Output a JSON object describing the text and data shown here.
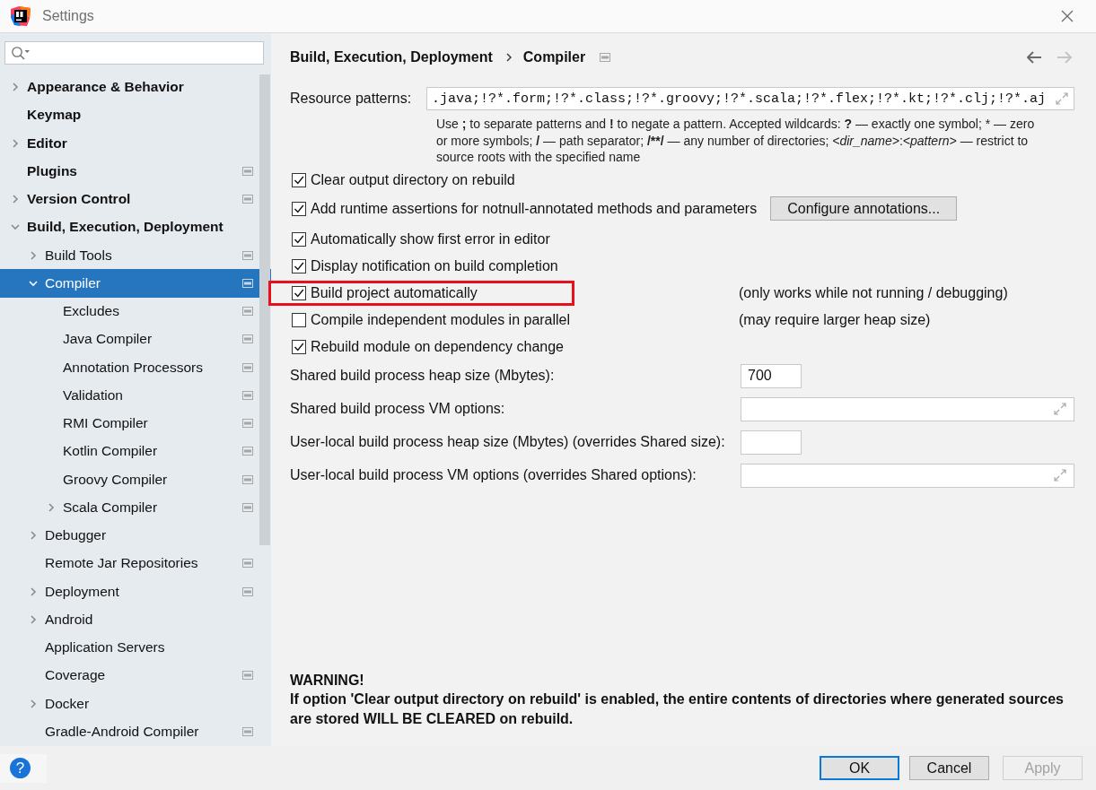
{
  "window": {
    "title": "Settings"
  },
  "sidebar": {
    "items": [
      {
        "label": "Appearance & Behavior",
        "expanded": false,
        "project_level": false,
        "selected": false
      },
      {
        "label": "Keymap",
        "project_level": false,
        "selected": false
      },
      {
        "label": "Editor",
        "expanded": false,
        "project_level": false,
        "selected": false
      },
      {
        "label": "Plugins",
        "project_level": true,
        "selected": false
      },
      {
        "label": "Version Control",
        "expanded": false,
        "project_level": true,
        "selected": false
      },
      {
        "label": "Build, Execution, Deployment",
        "expanded": true,
        "project_level": false,
        "selected": false,
        "children": [
          {
            "label": "Build Tools",
            "expanded": false,
            "project_level": true,
            "selected": false
          },
          {
            "label": "Compiler",
            "expanded": true,
            "project_level": true,
            "selected": true,
            "children": [
              {
                "label": "Excludes",
                "project_level": true,
                "selected": false
              },
              {
                "label": "Java Compiler",
                "project_level": true,
                "selected": false
              },
              {
                "label": "Annotation Processors",
                "project_level": true,
                "selected": false
              },
              {
                "label": "Validation",
                "project_level": true,
                "selected": false
              },
              {
                "label": "RMI Compiler",
                "project_level": true,
                "selected": false
              },
              {
                "label": "Kotlin Compiler",
                "project_level": true,
                "selected": false
              },
              {
                "label": "Groovy Compiler",
                "project_level": true,
                "selected": false
              },
              {
                "label": "Scala Compiler",
                "expanded": false,
                "project_level": true,
                "selected": false
              }
            ]
          },
          {
            "label": "Debugger",
            "expanded": false,
            "project_level": false,
            "selected": false
          },
          {
            "label": "Remote Jar Repositories",
            "project_level": true,
            "selected": false
          },
          {
            "label": "Deployment",
            "expanded": false,
            "project_level": true,
            "selected": false
          },
          {
            "label": "Android",
            "expanded": false,
            "project_level": false,
            "selected": false
          },
          {
            "label": "Application Servers",
            "project_level": false,
            "selected": false
          },
          {
            "label": "Coverage",
            "project_level": true,
            "selected": false
          },
          {
            "label": "Docker",
            "expanded": false,
            "project_level": false,
            "selected": false
          },
          {
            "label": "Gradle-Android Compiler",
            "project_level": true,
            "selected": false
          }
        ]
      }
    ]
  },
  "breadcrumb": {
    "items": [
      "Build, Execution, Deployment",
      "Compiler"
    ],
    "project_level": true
  },
  "nav": [
    {
      "kind": "back",
      "disabled": false
    },
    {
      "kind": "forward",
      "disabled": true
    }
  ],
  "resource_patterns": {
    "label": "Resource patterns:",
    "value": ".java;!?*.form;!?*.class;!?*.groovy;!?*.scala;!?*.flex;!?*.kt;!?*.clj;!?*.aj",
    "hint": [
      {
        "text": "Use ",
        "kind": "text"
      },
      {
        "text": ";",
        "kind": "symbol"
      },
      {
        "text": " to separate patterns and ",
        "kind": "text"
      },
      {
        "text": "!",
        "kind": "symbol"
      },
      {
        "text": " to negate a pattern. Accepted wildcards: ",
        "kind": "text"
      },
      {
        "text": "?",
        "kind": "symbol"
      },
      {
        "text": " — exactly one symbol; * — zero or more symbols; ",
        "kind": "text"
      },
      {
        "text": "/",
        "kind": "symbol"
      },
      {
        "text": " — path separator; ",
        "kind": "text"
      },
      {
        "text": "/**/",
        "kind": "symbol"
      },
      {
        "text": " — any number of directories;  ",
        "kind": "text"
      },
      {
        "text": "<dir_name>",
        "kind": "placeholder"
      },
      {
        "text": ":",
        "kind": "text"
      },
      {
        "text": "<pattern>",
        "kind": "placeholder"
      },
      {
        "text": " — restrict to source roots with the specified name",
        "kind": "text"
      }
    ]
  },
  "options": [
    {
      "label": "Clear output directory on rebuild",
      "checked": true,
      "highlighted": false
    },
    {
      "label": "Add runtime assertions for notnull-annotated methods and parameters",
      "checked": true,
      "highlighted": false,
      "button": "Configure annotations..."
    },
    {
      "label": "Automatically show first error in editor",
      "checked": true,
      "highlighted": false
    },
    {
      "label": "Display notification on build completion",
      "checked": true,
      "highlighted": false
    },
    {
      "label": "Build project automatically",
      "checked": true,
      "highlighted": true,
      "note": "(only works while not running / debugging)"
    },
    {
      "label": "Compile independent modules in parallel",
      "checked": false,
      "highlighted": false,
      "note": "(may require larger heap size)"
    },
    {
      "label": "Rebuild module on dependency change",
      "checked": true,
      "highlighted": false
    }
  ],
  "fields": [
    {
      "kind": "short",
      "label": "Shared build process heap size (Mbytes):",
      "value": "700"
    },
    {
      "kind": "wide",
      "label": "Shared build process VM options:"
    },
    {
      "kind": "short",
      "label": "User-local build process heap size (Mbytes) (overrides Shared size):"
    },
    {
      "kind": "wide",
      "label": "User-local build process VM options (overrides Shared options):"
    }
  ],
  "warning": {
    "title": "WARNING!",
    "text": "If option 'Clear output directory on rebuild' is enabled, the entire contents of directories where generated sources are stored WILL BE CLEARED on rebuild."
  },
  "help_button": {
    "label": "?"
  },
  "buttons": [
    {
      "label": "OK",
      "default": true,
      "disabled": false
    },
    {
      "label": "Cancel",
      "default": false,
      "disabled": false
    },
    {
      "label": "Apply",
      "default": false,
      "disabled": true
    }
  ]
}
